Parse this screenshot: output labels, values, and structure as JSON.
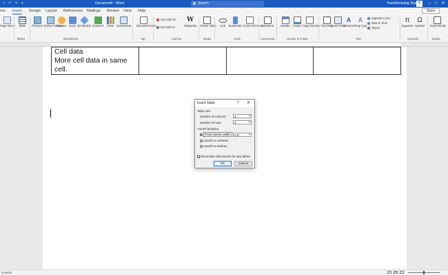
{
  "app": {
    "doc_title": "Document4  -  Word",
    "search_placeholder": "Search",
    "user": "TeachKnowing Teacher",
    "avatar": "T",
    "share": "Share"
  },
  "tabs": [
    "me",
    "Insert",
    "Design",
    "Layout",
    "References",
    "Mailings",
    "Review",
    "View",
    "Help"
  ],
  "ribbon": {
    "page_break": "Page Break",
    "table": "Table",
    "picture": "Pictures",
    "online_pictures": "Online Pictures",
    "shapes": "Shapes",
    "icons": "Icons",
    "models_3d": "3D Models",
    "smartart": "SmartArt",
    "chart": "Chart",
    "screenshot": "Screenshot",
    "document_item": "Document Item",
    "get_addins": "Get Add-ins",
    "my_addins": "My Add-ins",
    "wikipedia": "Wikipedia",
    "online_video": "Online Video",
    "link": "Link",
    "bookmark": "Bookmark",
    "cross_reference": "Cross-reference",
    "comment": "Comment",
    "header": "Header",
    "footer": "Footer",
    "page_number": "Page Number",
    "text_box": "Text Box",
    "quick_parts": "Quick Parts",
    "wordart": "WordArt",
    "drop_cap": "Drop Cap",
    "signature_line": "Signature Line",
    "date_time": "Date & Time",
    "object": "Object",
    "equation": "Equation",
    "symbol": "Symbol",
    "insert_media": "Insert Media",
    "groups": {
      "tables": "Tables",
      "illustrations": "Illustrations",
      "tap": "Tap",
      "addins": "Add-ins",
      "media": "Media",
      "links": "Links",
      "comments": "Comments",
      "header_footer": "Header & Footer",
      "text": "Text",
      "symbols": "Symbols",
      "media2": "Media"
    }
  },
  "document": {
    "cell_lines": [
      "Cell data",
      "More cell data in same",
      "cell."
    ]
  },
  "dialog": {
    "title": "Insert Table",
    "help": "?",
    "close": "✕",
    "table_size": "Table size",
    "num_columns_label": "Number of columns:",
    "num_columns": "4",
    "num_rows_label": "Number of rows:",
    "num_rows": "3",
    "autofit_label": "AutoFit behavior",
    "fixed_width": "Fixed column width:",
    "fixed_width_value": "0.5\"",
    "autofit_contents": "AutoFit to contents",
    "autofit_window": "AutoFit to window",
    "remember": "Remember dimensions for new tables",
    "ok": "OK",
    "cancel": "Cancel"
  },
  "status": {
    "words": "9 words"
  },
  "colors": {
    "brand": "#185abd",
    "ribbon_bg": "#f3f3f3"
  }
}
